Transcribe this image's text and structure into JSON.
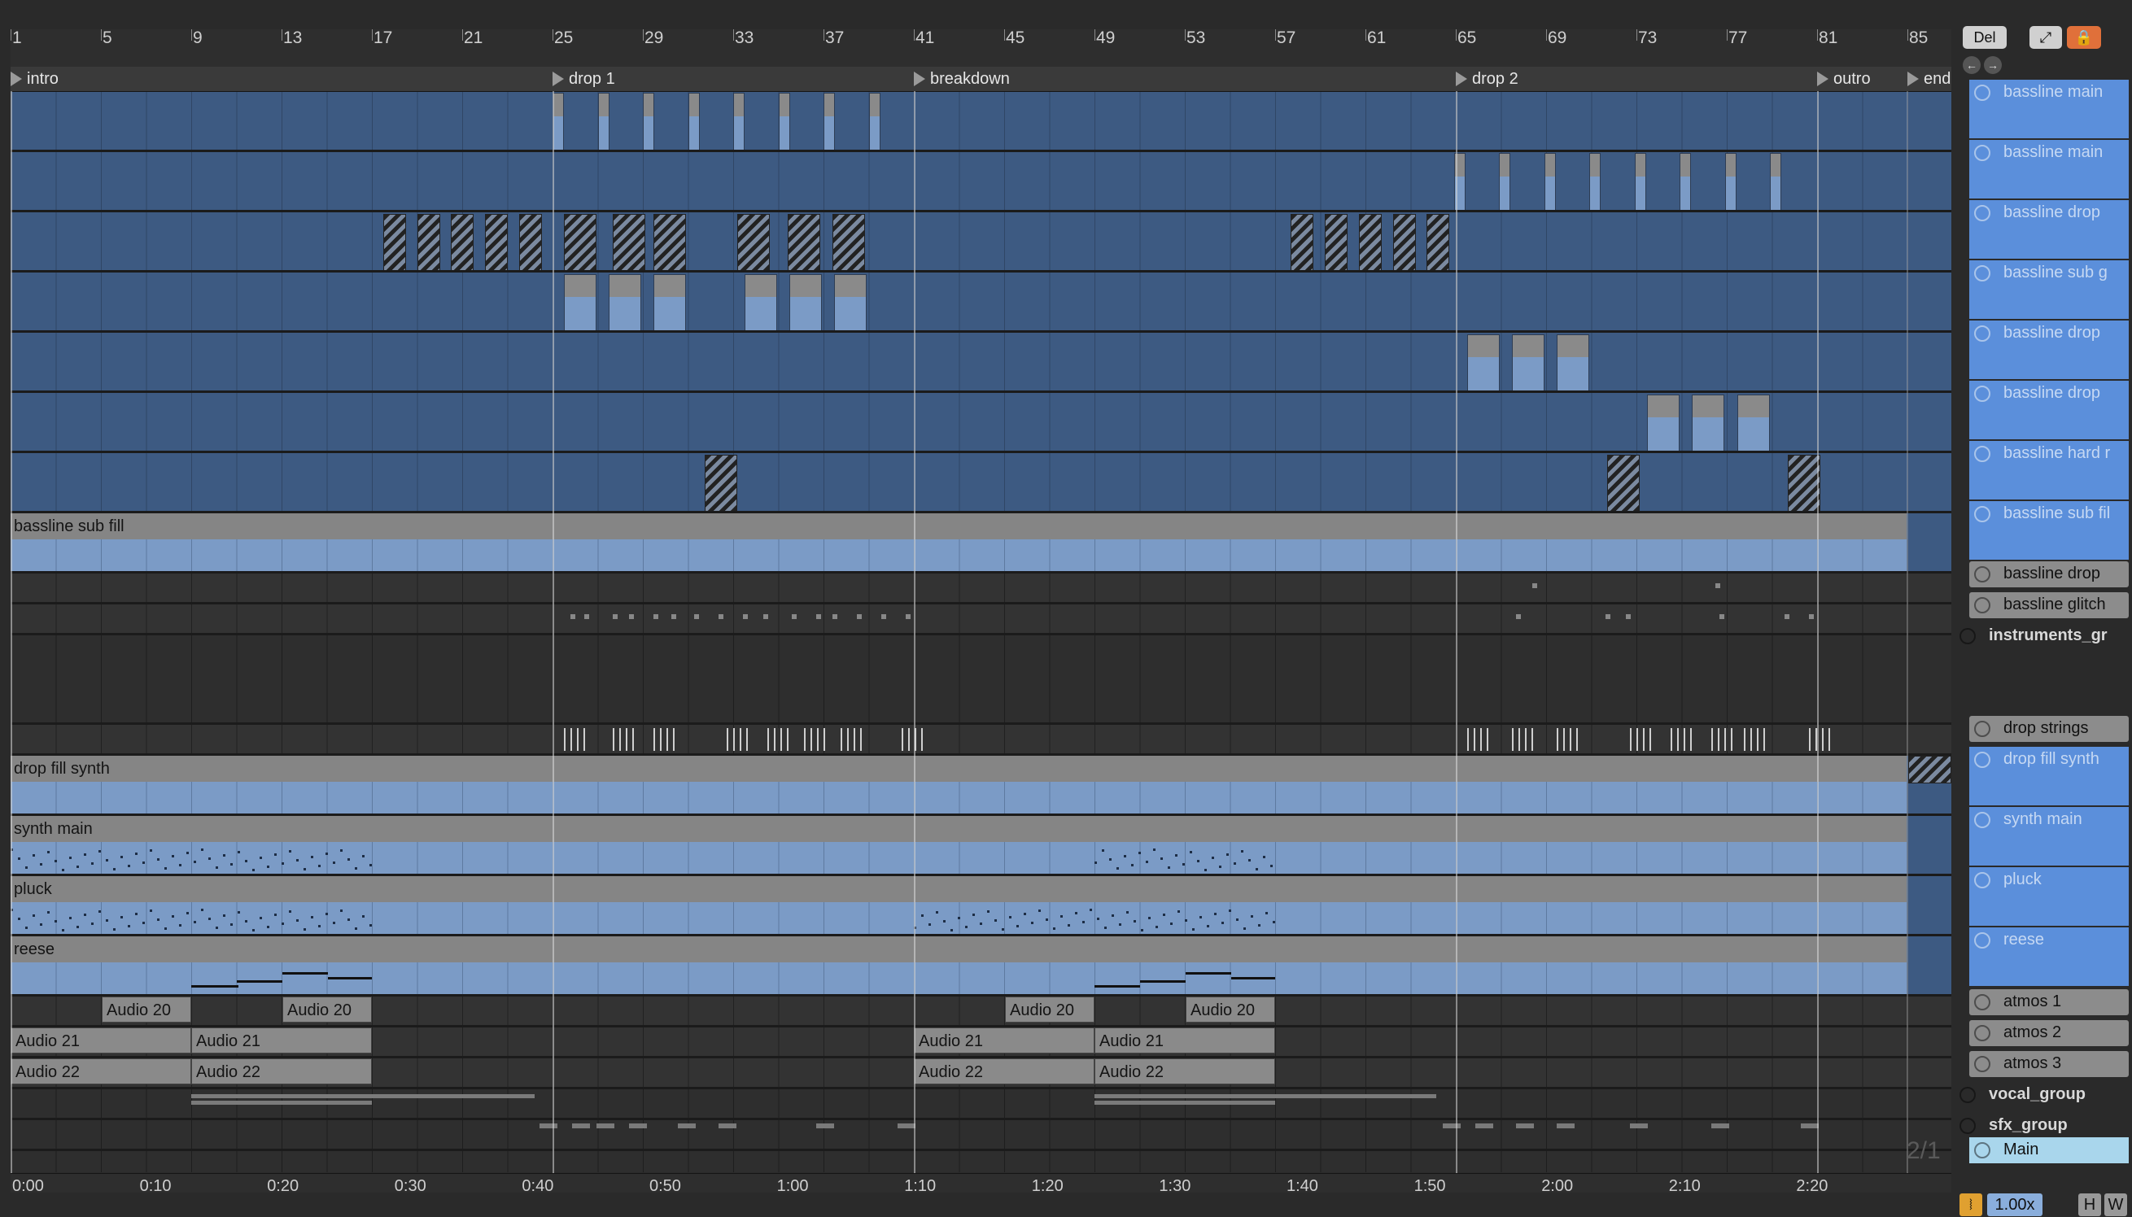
{
  "ruler": {
    "bars": [
      "1",
      "5",
      "9",
      "13",
      "17",
      "21",
      "25",
      "29",
      "33",
      "37",
      "41",
      "45",
      "49",
      "53",
      "57",
      "61",
      "65",
      "69",
      "73",
      "77",
      "81",
      "85"
    ]
  },
  "locators": [
    "intro",
    "drop 1",
    "breakdown",
    "drop 2",
    "outro",
    "end"
  ],
  "lanes": {
    "bassline_sub_fill": "bassline sub fill",
    "drop_fill_synth": "drop fill synth",
    "synth_main": "synth main",
    "pluck": "pluck",
    "reese": "reese"
  },
  "audio_clips": {
    "audio20": "Audio 20",
    "audio21": "Audio 21",
    "audio22": "Audio 22"
  },
  "time_ruler": [
    "0:00",
    "0:10",
    "0:20",
    "0:30",
    "0:40",
    "0:50",
    "1:00",
    "1:10",
    "1:20",
    "1:30",
    "1:40",
    "1:50",
    "2:00",
    "2:10",
    "2:20"
  ],
  "controls": {
    "del_label": "Del",
    "page_fraction": "2/1",
    "zoom": "1.00x",
    "h_label": "H",
    "w_label": "W"
  },
  "tracks": [
    {
      "label": "bassline main"
    },
    {
      "label": "bassline main"
    },
    {
      "label": "bassline drop"
    },
    {
      "label": "bassline sub g"
    },
    {
      "label": "bassline drop"
    },
    {
      "label": "bassline drop"
    },
    {
      "label": "bassline hard r"
    },
    {
      "label": "bassline sub fil"
    },
    {
      "label": "bassline drop"
    },
    {
      "label": "bassline glitch"
    },
    {
      "label": "instruments_gr"
    },
    {
      "label": "drop strings"
    },
    {
      "label": "drop fill synth"
    },
    {
      "label": "synth main"
    },
    {
      "label": "pluck"
    },
    {
      "label": "reese"
    },
    {
      "label": "atmos 1"
    },
    {
      "label": "atmos 2"
    },
    {
      "label": "atmos 3"
    },
    {
      "label": "vocal_group"
    },
    {
      "label": "sfx_group"
    },
    {
      "label": "Main"
    }
  ],
  "colors": {
    "lane_blue": "#3d5a82",
    "clip_blue": "#7b9bc6",
    "track_blue": "#5b8fdb",
    "main_track": "#a9d6ec",
    "record_orange": "#e0703a"
  }
}
